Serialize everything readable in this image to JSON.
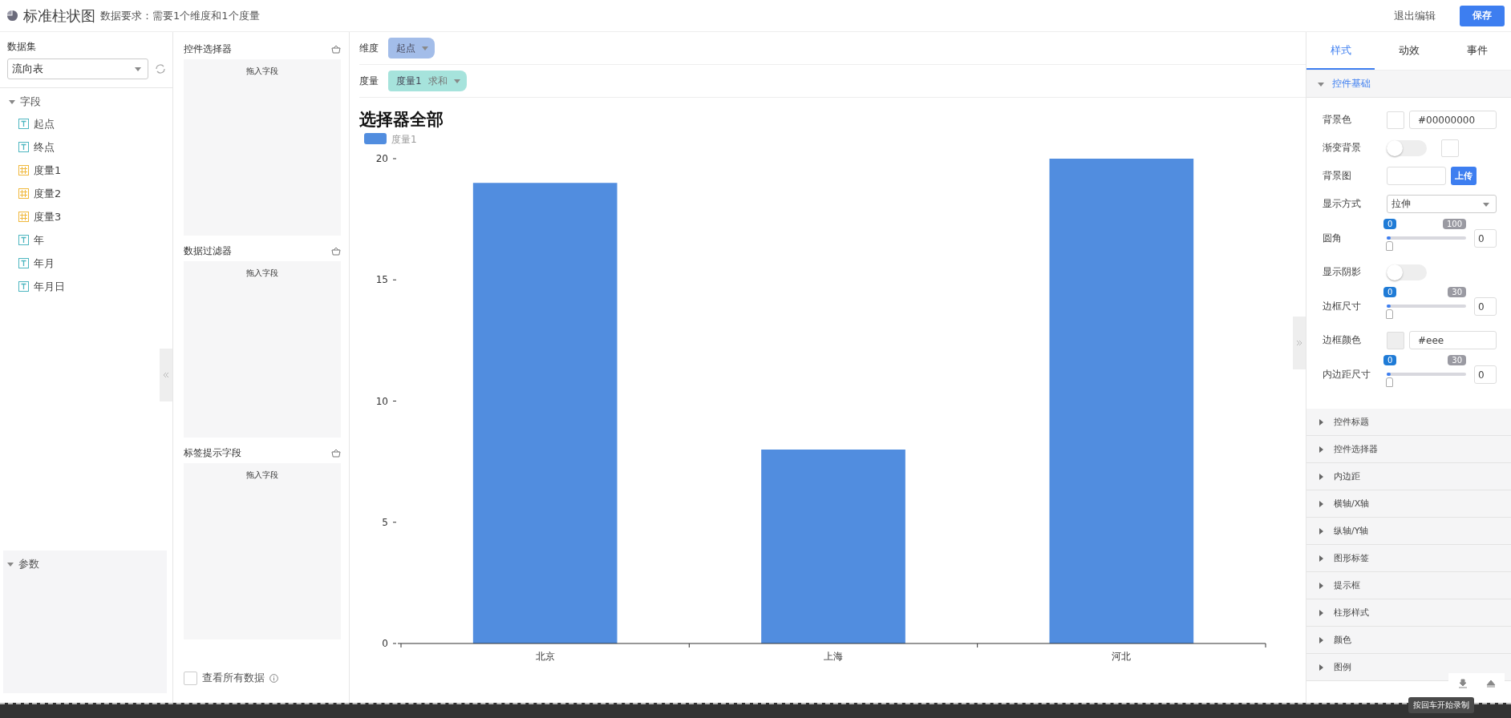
{
  "header": {
    "title": "标准柱状图",
    "requirement": "数据要求：需要1个维度和1个度量",
    "exit_button": "退出编辑",
    "save_button": "保存"
  },
  "left": {
    "dataset_label": "数据集",
    "dataset_value": "流向表",
    "fields": {
      "label": "字段",
      "expanded": true,
      "children": [
        {
          "name": "起点",
          "kind": "text"
        },
        {
          "name": "终点",
          "kind": "text"
        },
        {
          "name": "度量1",
          "kind": "number"
        },
        {
          "name": "度量2",
          "kind": "number"
        },
        {
          "name": "度量3",
          "kind": "number"
        },
        {
          "name": "年",
          "kind": "text"
        },
        {
          "name": "年月",
          "kind": "text"
        },
        {
          "name": "年月日",
          "kind": "text"
        }
      ]
    },
    "params": {
      "label": "参数",
      "expanded": true
    }
  },
  "middle": {
    "sections": [
      {
        "title": "控件选择器",
        "placeholder": "拖入字段"
      },
      {
        "title": "数据过滤器",
        "placeholder": "拖入字段"
      },
      {
        "title": "标签提示字段",
        "placeholder": "拖入字段"
      }
    ],
    "show_all": {
      "label": "查看所有数据",
      "checked": false
    }
  },
  "canvas": {
    "dimension": {
      "label": "维度",
      "chip": "起点"
    },
    "measure": {
      "label": "度量",
      "chip": "度量1",
      "aggregate": "求和"
    },
    "title": "选择器全部",
    "chart_data": {
      "type": "bar",
      "categories": [
        "北京",
        "上海",
        "河北"
      ],
      "series": [
        {
          "name": "度量1",
          "color": "#518ddf",
          "values": [
            19,
            8,
            20
          ]
        }
      ],
      "ylim": [
        0,
        20
      ],
      "yticks": [
        0,
        5,
        10,
        15,
        20
      ]
    }
  },
  "right": {
    "tabs": [
      {
        "label": "样式",
        "selected": true
      },
      {
        "label": "动效",
        "selected": false
      },
      {
        "label": "事件",
        "selected": false
      }
    ],
    "section": {
      "label": "控件基础",
      "expanded": true
    },
    "properties": [
      {
        "kind": "color",
        "label": "背景色",
        "value": "#00000000"
      },
      {
        "kind": "toggle",
        "label": "渐变背景",
        "on": false,
        "swatch": true
      },
      {
        "kind": "upload",
        "label": "背景图",
        "button": "上传"
      },
      {
        "kind": "select",
        "label": "显示方式",
        "value": "拉伸"
      },
      {
        "kind": "slider",
        "label": "圆角",
        "min": "0",
        "max": "100",
        "value": "0",
        "level": 0
      },
      {
        "kind": "toggle",
        "label": "显示阴影",
        "on": false,
        "swatch": false
      },
      {
        "kind": "slider",
        "label": "边框尺寸",
        "min": "0",
        "max": "30",
        "value": "0",
        "level": 0
      },
      {
        "kind": "color",
        "label": "边框颜色",
        "value": "#eee"
      },
      {
        "kind": "slider",
        "label": "内边距尺寸",
        "min": "0",
        "max": "30",
        "value": "0",
        "level": 0
      }
    ],
    "accordions": [
      {
        "label": "控件标题",
        "expanded": false
      },
      {
        "label": "控件选择器",
        "expanded": false
      },
      {
        "label": "内边距",
        "expanded": false
      },
      {
        "label": "横轴/X轴",
        "expanded": false
      },
      {
        "label": "纵轴/Y轴",
        "expanded": false
      },
      {
        "label": "图形标签",
        "expanded": false
      },
      {
        "label": "提示框",
        "expanded": false
      },
      {
        "label": "柱形样式",
        "expanded": false
      },
      {
        "label": "颜色",
        "expanded": false
      },
      {
        "label": "图例",
        "expanded": false
      }
    ]
  },
  "recorder": {
    "tooltip": "按回车开始录制"
  }
}
